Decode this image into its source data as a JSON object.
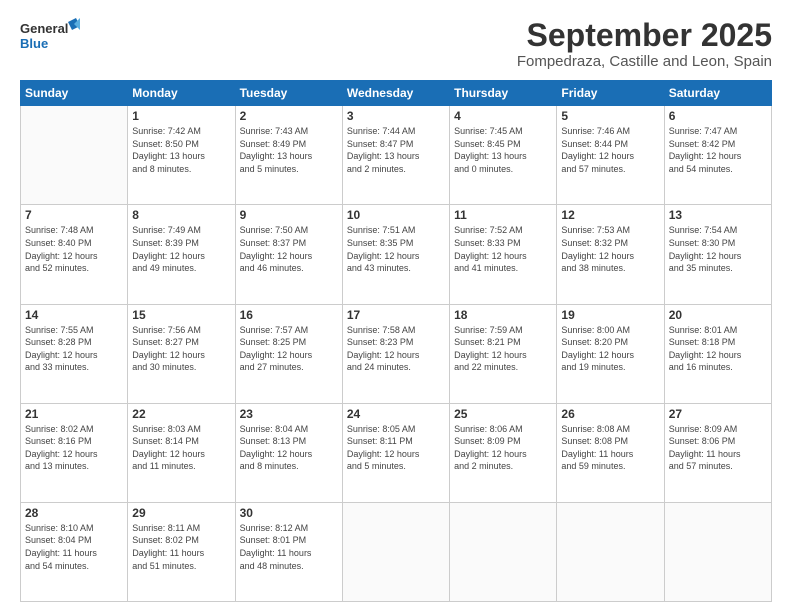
{
  "logo": {
    "line1": "General",
    "line2": "Blue"
  },
  "title": "September 2025",
  "subtitle": "Fompedraza, Castille and Leon, Spain",
  "headers": [
    "Sunday",
    "Monday",
    "Tuesday",
    "Wednesday",
    "Thursday",
    "Friday",
    "Saturday"
  ],
  "weeks": [
    [
      {
        "day": "",
        "info": ""
      },
      {
        "day": "1",
        "info": "Sunrise: 7:42 AM\nSunset: 8:50 PM\nDaylight: 13 hours\nand 8 minutes."
      },
      {
        "day": "2",
        "info": "Sunrise: 7:43 AM\nSunset: 8:49 PM\nDaylight: 13 hours\nand 5 minutes."
      },
      {
        "day": "3",
        "info": "Sunrise: 7:44 AM\nSunset: 8:47 PM\nDaylight: 13 hours\nand 2 minutes."
      },
      {
        "day": "4",
        "info": "Sunrise: 7:45 AM\nSunset: 8:45 PM\nDaylight: 13 hours\nand 0 minutes."
      },
      {
        "day": "5",
        "info": "Sunrise: 7:46 AM\nSunset: 8:44 PM\nDaylight: 12 hours\nand 57 minutes."
      },
      {
        "day": "6",
        "info": "Sunrise: 7:47 AM\nSunset: 8:42 PM\nDaylight: 12 hours\nand 54 minutes."
      }
    ],
    [
      {
        "day": "7",
        "info": "Sunrise: 7:48 AM\nSunset: 8:40 PM\nDaylight: 12 hours\nand 52 minutes."
      },
      {
        "day": "8",
        "info": "Sunrise: 7:49 AM\nSunset: 8:39 PM\nDaylight: 12 hours\nand 49 minutes."
      },
      {
        "day": "9",
        "info": "Sunrise: 7:50 AM\nSunset: 8:37 PM\nDaylight: 12 hours\nand 46 minutes."
      },
      {
        "day": "10",
        "info": "Sunrise: 7:51 AM\nSunset: 8:35 PM\nDaylight: 12 hours\nand 43 minutes."
      },
      {
        "day": "11",
        "info": "Sunrise: 7:52 AM\nSunset: 8:33 PM\nDaylight: 12 hours\nand 41 minutes."
      },
      {
        "day": "12",
        "info": "Sunrise: 7:53 AM\nSunset: 8:32 PM\nDaylight: 12 hours\nand 38 minutes."
      },
      {
        "day": "13",
        "info": "Sunrise: 7:54 AM\nSunset: 8:30 PM\nDaylight: 12 hours\nand 35 minutes."
      }
    ],
    [
      {
        "day": "14",
        "info": "Sunrise: 7:55 AM\nSunset: 8:28 PM\nDaylight: 12 hours\nand 33 minutes."
      },
      {
        "day": "15",
        "info": "Sunrise: 7:56 AM\nSunset: 8:27 PM\nDaylight: 12 hours\nand 30 minutes."
      },
      {
        "day": "16",
        "info": "Sunrise: 7:57 AM\nSunset: 8:25 PM\nDaylight: 12 hours\nand 27 minutes."
      },
      {
        "day": "17",
        "info": "Sunrise: 7:58 AM\nSunset: 8:23 PM\nDaylight: 12 hours\nand 24 minutes."
      },
      {
        "day": "18",
        "info": "Sunrise: 7:59 AM\nSunset: 8:21 PM\nDaylight: 12 hours\nand 22 minutes."
      },
      {
        "day": "19",
        "info": "Sunrise: 8:00 AM\nSunset: 8:20 PM\nDaylight: 12 hours\nand 19 minutes."
      },
      {
        "day": "20",
        "info": "Sunrise: 8:01 AM\nSunset: 8:18 PM\nDaylight: 12 hours\nand 16 minutes."
      }
    ],
    [
      {
        "day": "21",
        "info": "Sunrise: 8:02 AM\nSunset: 8:16 PM\nDaylight: 12 hours\nand 13 minutes."
      },
      {
        "day": "22",
        "info": "Sunrise: 8:03 AM\nSunset: 8:14 PM\nDaylight: 12 hours\nand 11 minutes."
      },
      {
        "day": "23",
        "info": "Sunrise: 8:04 AM\nSunset: 8:13 PM\nDaylight: 12 hours\nand 8 minutes."
      },
      {
        "day": "24",
        "info": "Sunrise: 8:05 AM\nSunset: 8:11 PM\nDaylight: 12 hours\nand 5 minutes."
      },
      {
        "day": "25",
        "info": "Sunrise: 8:06 AM\nSunset: 8:09 PM\nDaylight: 12 hours\nand 2 minutes."
      },
      {
        "day": "26",
        "info": "Sunrise: 8:08 AM\nSunset: 8:08 PM\nDaylight: 11 hours\nand 59 minutes."
      },
      {
        "day": "27",
        "info": "Sunrise: 8:09 AM\nSunset: 8:06 PM\nDaylight: 11 hours\nand 57 minutes."
      }
    ],
    [
      {
        "day": "28",
        "info": "Sunrise: 8:10 AM\nSunset: 8:04 PM\nDaylight: 11 hours\nand 54 minutes."
      },
      {
        "day": "29",
        "info": "Sunrise: 8:11 AM\nSunset: 8:02 PM\nDaylight: 11 hours\nand 51 minutes."
      },
      {
        "day": "30",
        "info": "Sunrise: 8:12 AM\nSunset: 8:01 PM\nDaylight: 11 hours\nand 48 minutes."
      },
      {
        "day": "",
        "info": ""
      },
      {
        "day": "",
        "info": ""
      },
      {
        "day": "",
        "info": ""
      },
      {
        "day": "",
        "info": ""
      }
    ]
  ]
}
